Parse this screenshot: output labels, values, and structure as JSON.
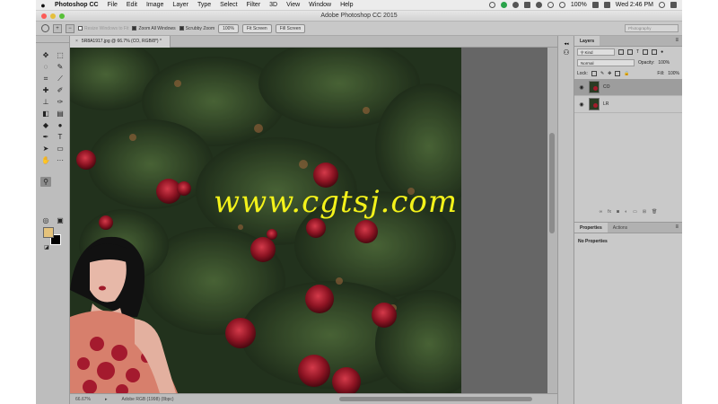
{
  "menubar": {
    "apple": "",
    "app": "Photoshop CC",
    "items": [
      "File",
      "Edit",
      "Image",
      "Layer",
      "Type",
      "Select",
      "Filter",
      "3D",
      "View",
      "Window",
      "Help"
    ],
    "battery": "100%",
    "clock": "Wed 2:46 PM"
  },
  "window": {
    "title": "Adobe Photoshop CC 2015"
  },
  "options": {
    "resize_windows": "Resize Windows to Fit",
    "zoom_all": "Zoom All Windows",
    "scrubby": "Scrubby Zoom",
    "zoom_100": "100%",
    "fit_screen": "Fit Screen",
    "fill_screen": "Fill Screen",
    "workspace": "Photography"
  },
  "document": {
    "tab_title": "5R8A1917.jpg @ 66.7% (CO, RGB/8*) *",
    "zoom": "66.67%",
    "profile": "Adobe RGB (1998) (8bpc)"
  },
  "watermark": "www.cgtsj.com",
  "layers_panel": {
    "tab": "Layers",
    "filter": "Kind",
    "blend": "Normal",
    "opacity_label": "Opacity:",
    "opacity": "100%",
    "lock_label": "Lock:",
    "fill_label": "Fill:",
    "fill": "100%",
    "layers": [
      {
        "name": "CO",
        "active": true
      },
      {
        "name": "LR",
        "active": false
      }
    ],
    "footer_icons": [
      "link-icon",
      "fx-icon",
      "mask-icon",
      "adjustment-icon",
      "folder-icon",
      "new-layer-icon",
      "trash-icon"
    ]
  },
  "properties_panel": {
    "tab": "Properties",
    "tab2": "Actions",
    "body": "No Properties"
  },
  "colors": {
    "foreground": "#e5c37c",
    "background": "#000000",
    "watermark": "#f3f21a"
  },
  "tools": [
    "move-icon",
    "marquee-icon",
    "lasso-icon",
    "quick-select-icon",
    "crop-icon",
    "eyedropper-icon",
    "healing-icon",
    "brush-icon",
    "clone-stamp-icon",
    "history-brush-icon",
    "eraser-icon",
    "gradient-icon",
    "blur-icon",
    "dodge-icon",
    "pen-icon",
    "type-icon",
    "path-select-icon",
    "shape-icon",
    "hand-icon",
    "zoom-icon"
  ]
}
